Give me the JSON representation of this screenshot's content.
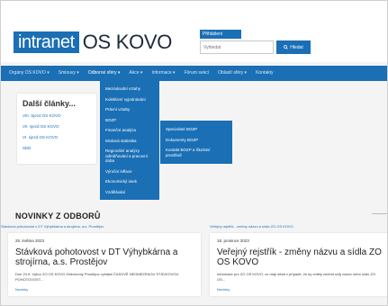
{
  "header": {
    "logo_badge": "intranet",
    "logo_text": "OS KOVO",
    "login_label": "Přihlášení",
    "search_placeholder": "Vyhledat",
    "search_button": "Hledat"
  },
  "navbar": {
    "items": [
      {
        "label": "Orgány OS KOVO ▾"
      },
      {
        "label": "Smlouvy ▾"
      },
      {
        "label": "Odborné sféry ▾"
      },
      {
        "label": "Akce ▾"
      },
      {
        "label": "Informace ▾"
      },
      {
        "label": "Fórum sekcí"
      },
      {
        "label": "Oblastí sféry ▾"
      },
      {
        "label": "Kontakty"
      }
    ]
  },
  "dropdown": {
    "items": [
      {
        "label": "Mezinárodní vztahy"
      },
      {
        "label": "Kolektivní vyjednávání"
      },
      {
        "label": "Právní vztahy"
      },
      {
        "label": "BOZP"
      },
      {
        "label": "Finanční analýza"
      },
      {
        "label": "Mzdová statistika"
      },
      {
        "label": "Regionální analýzy odměňování a pracovní doba"
      },
      {
        "label": "Výroční inflace"
      },
      {
        "label": "Ekonomický úsek"
      },
      {
        "label": "Vzdělávání"
      }
    ],
    "submenu": [
      {
        "label": "Specialisté BOZP"
      },
      {
        "label": "Dokumenty BOZP"
      },
      {
        "label": "Kontakt BOZP a Školství prostředí"
      }
    ]
  },
  "sidebar": {
    "title": "Další články...",
    "links": [
      {
        "label": "VIII. Sjezd OS KOVO"
      },
      {
        "label": "VII. sjezd OS KOVO"
      },
      {
        "label": "VI. sjezd OS KOVO"
      },
      {
        "label": "Sběr"
      }
    ]
  },
  "news": {
    "heading": "NOVINKY Z ODBORŮ",
    "cards": [
      {
        "tag": "Stávková pohotovost v DT Výhybkárna a strojírna, a.s. Prostějov",
        "date": "25. května 2023",
        "title": "Stávková pohotovost v DT Výhybkárna a strojírna, a.s. Prostějov",
        "excerpt": "Dne 23.5. Výbor ZO OS KOVO Zeleznomy Prostějov vyhlásil ČASOVĚ NEOMEZENOU STÁVKOVOU POHOTOVOST...",
        "more": "Novinky"
      },
      {
        "tag": "Veřejný rejstřík - změny názvu a sídla ZO OS KOVO",
        "date": "18. prosince 2023",
        "title": "Veřejný rejstřík - změny názvu a sídla ZO OS KOVO",
        "excerpt": "Informace pro ZO OS KOVO, co mají dělat v případě, že by chtěly změnit svůj název nebo sídlo ZO OS...",
        "more": "Novinky"
      }
    ]
  },
  "colors": {
    "primary": "#1a6fb5",
    "background": "#f4f4f4"
  }
}
